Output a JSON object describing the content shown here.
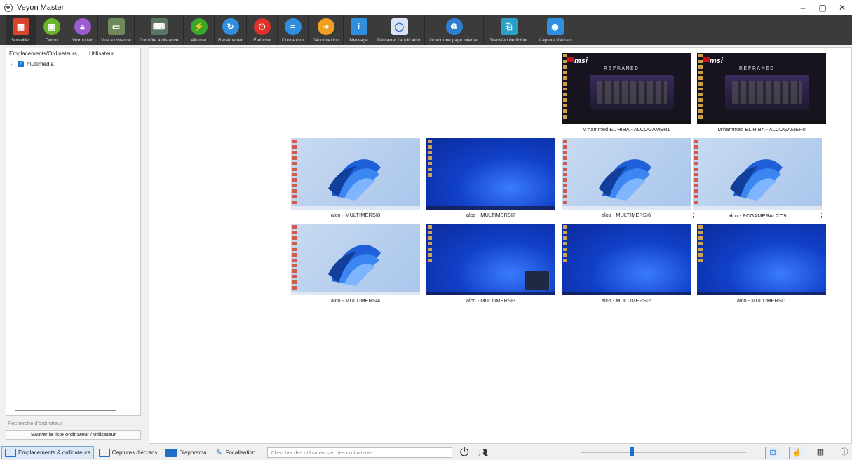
{
  "window": {
    "title": "Veyon Master",
    "controls": [
      "–",
      "▢",
      "✕"
    ]
  },
  "toolbar": [
    {
      "id": "surveiller",
      "label": "Surveiller",
      "color": "#d6442f",
      "glyph": "▦"
    },
    {
      "id": "demo",
      "label": "Démo",
      "color": "#6bb52b",
      "glyph": "▣"
    },
    {
      "id": "verrouiller",
      "label": "Verrouiller",
      "color": "#9b5bd1",
      "glyph": "🔒︎"
    },
    {
      "id": "vue-distance",
      "label": "Vue à distance",
      "color": "#6e8a5a",
      "glyph": "▭"
    },
    {
      "id": "controle-distance",
      "label": "Contrôle à distance",
      "color": "#5c7560",
      "glyph": "⌨"
    },
    {
      "id": "allumer",
      "label": "Allumer",
      "color": "#3aa82f",
      "glyph": "⚡"
    },
    {
      "id": "redemarrer",
      "label": "Redémarrer",
      "color": "#2f8ee0",
      "glyph": "↻"
    },
    {
      "id": "eteindre",
      "label": "Éteindre",
      "color": "#e0302a",
      "glyph": "⏻"
    },
    {
      "id": "connexion",
      "label": "Connexion",
      "color": "#2f8ee0",
      "glyph": "="
    },
    {
      "id": "deconnexion",
      "label": "Déconnexion",
      "color": "#f0a020",
      "glyph": "➜"
    },
    {
      "id": "message",
      "label": "Message",
      "color": "#2f8ee0",
      "glyph": "i"
    },
    {
      "id": "demarrer-application",
      "label": "Démarrer l'application",
      "color": "#d8e4f4",
      "glyph": "◯"
    },
    {
      "id": "ouvrir-page-internet",
      "label": "Ouvrir une page internet",
      "color": "#2f7fd0",
      "glyph": "🌐︎"
    },
    {
      "id": "transfert-fichier",
      "label": "Transfert de fichier",
      "color": "#2aa0c8",
      "glyph": "⎘"
    },
    {
      "id": "capture-ecran",
      "label": "Capture d'écran",
      "color": "#2f8ee0",
      "glyph": "◉"
    }
  ],
  "sidebar": {
    "col_computers": "Emplacements/Ordinateurs",
    "col_user": "Utilisateur",
    "tree": [
      {
        "label": "multimedia",
        "checked": true
      }
    ],
    "search_placeholder": "Recherche d'ordinateur",
    "save_button": "Sauver la liste ordinateur / utilisateur"
  },
  "tiles": [
    {
      "label": "M'hammed EL HIBA - ALCOGAMER1",
      "wallpaper": "msi",
      "selected": false
    },
    {
      "label": "M'hammed EL HIBA - ALCOGAMER0",
      "wallpaper": "msi",
      "selected": false
    },
    {
      "label": "alco - MULTIMERSI8",
      "wallpaper": "bloom",
      "selected": false
    },
    {
      "label": "alco - MULTIMERSI7",
      "wallpaper": "blue",
      "selected": false
    },
    {
      "label": "alco - MULTIMERSI6",
      "wallpaper": "bloom",
      "selected": false
    },
    {
      "label": "alco - PCGAMERALCO9",
      "wallpaper": "bloom",
      "selected": true
    },
    {
      "label": "alco - MULTIMERSI4",
      "wallpaper": "bloom",
      "selected": false
    },
    {
      "label": "alco - MULTIMERSI3",
      "wallpaper": "blue",
      "selected": false
    },
    {
      "label": "alco - MULTIMERSI2",
      "wallpaper": "blue",
      "selected": false
    },
    {
      "label": "alco - MULTIMERSI1",
      "wallpaper": "blue",
      "selected": false
    }
  ],
  "msi_wallpaper": {
    "brand": "msi",
    "headline": "REFRAMED"
  },
  "bottombar": {
    "tabs": [
      {
        "id": "emplacements",
        "label": "Emplacements & ordinateurs",
        "active": true
      },
      {
        "id": "captures",
        "label": "Captures d'écrans",
        "active": false
      },
      {
        "id": "diaporama",
        "label": "Diaporama",
        "active": false
      },
      {
        "id": "focalisation",
        "label": "Focalisation",
        "active": false
      }
    ],
    "search_placeholder": "Chercher des utilisateurs et des ordinateurs",
    "zoom_level": 0.3
  }
}
